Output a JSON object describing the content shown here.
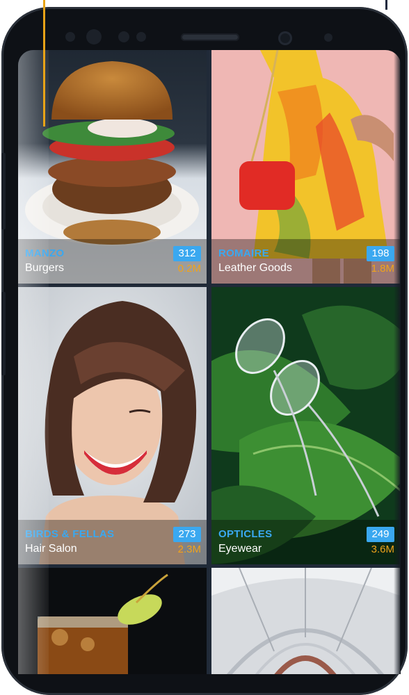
{
  "colors": {
    "accent_line": "#e8a317",
    "brand_text": "#3aa8f0",
    "badge_bg": "#3aa8f0",
    "metric_text": "#f0a31b",
    "grid_bg": "#202a38"
  },
  "tiles": [
    {
      "brand": "Manzo",
      "category": "Burgers",
      "count": "312",
      "metric": "0.2M",
      "image": "burger-photo"
    },
    {
      "brand": "Romaire",
      "category": "Leather Goods",
      "count": "198",
      "metric": "1.8M",
      "image": "dress-handbag-photo"
    },
    {
      "brand": "Birds & Fellas",
      "category": "Hair Salon",
      "count": "273",
      "metric": "2.3M",
      "image": "smiling-woman-bob-haircut-photo"
    },
    {
      "brand": "Opticles",
      "category": "Eyewear",
      "count": "249",
      "metric": "3.6M",
      "image": "glasses-on-leaves-photo"
    },
    {
      "brand": "",
      "category": "",
      "count": "",
      "metric": "",
      "image": "iced-tea-drink-photo"
    },
    {
      "brand": "",
      "category": "",
      "count": "",
      "metric": "",
      "image": "glass-dome-ceiling-photo"
    }
  ]
}
